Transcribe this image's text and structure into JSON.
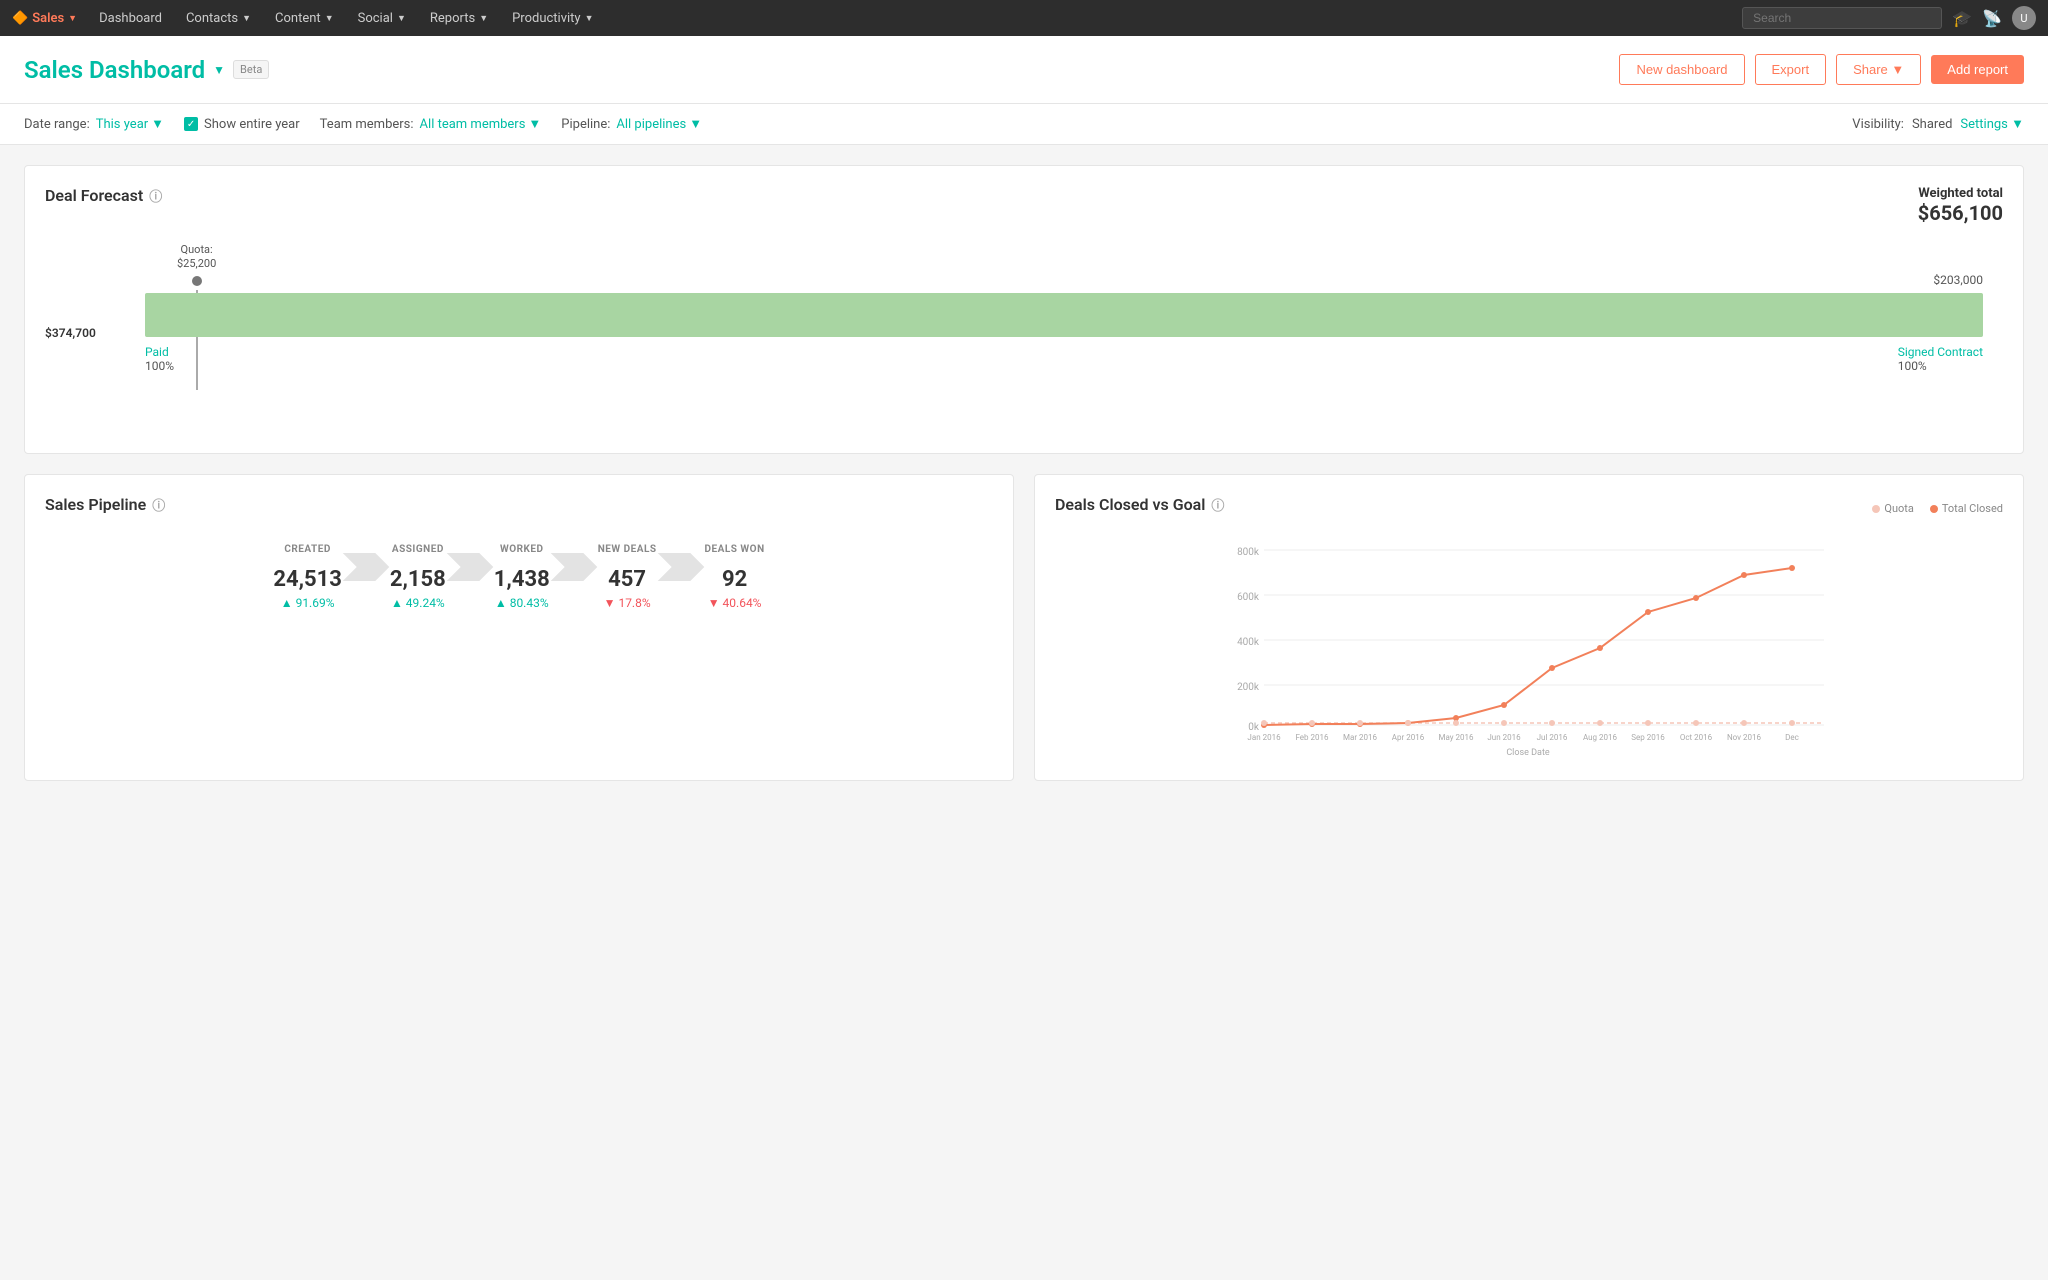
{
  "nav": {
    "brand": "Sales",
    "items": [
      "Dashboard",
      "Contacts",
      "Content",
      "Social",
      "Reports",
      "Productivity"
    ],
    "search_placeholder": "Search"
  },
  "header": {
    "title": "Sales Dashboard",
    "beta_label": "Beta",
    "actions": {
      "new_dashboard": "New dashboard",
      "export": "Export",
      "share": "Share",
      "add_report": "Add report"
    }
  },
  "filters": {
    "date_range_label": "Date range:",
    "date_range_value": "This year",
    "show_entire_year": "Show entire year",
    "team_members_label": "Team members:",
    "team_members_value": "All team members",
    "pipeline_label": "Pipeline:",
    "pipeline_value": "All pipelines",
    "visibility_label": "Visibility:",
    "visibility_value": "Shared",
    "settings": "Settings"
  },
  "deal_forecast": {
    "title": "Deal Forecast",
    "weighted_label": "Weighted total",
    "weighted_amount": "$656,100",
    "bar_left_value": "$374,700",
    "bar_right_value": "$203,000",
    "quota_label": "Quota:",
    "quota_amount": "$25,200",
    "stages": [
      {
        "name": "Paid",
        "pct": "100%"
      },
      {
        "name": "Signed Contract",
        "pct": "100%"
      }
    ]
  },
  "sales_pipeline": {
    "title": "Sales Pipeline",
    "stages": [
      {
        "label": "CREATED",
        "value": "24,513",
        "change": "▲ 91.69%",
        "up": true
      },
      {
        "label": "ASSIGNED",
        "value": "2,158",
        "change": "▲ 49.24%",
        "up": true
      },
      {
        "label": "WORKED",
        "value": "1,438",
        "change": "▲ 80.43%",
        "up": true
      },
      {
        "label": "NEW DEALS",
        "value": "457",
        "change": "▼ 17.8%",
        "up": false
      },
      {
        "label": "DEALS WON",
        "value": "92",
        "change": "▼ 40.64%",
        "up": false
      }
    ]
  },
  "deals_closed": {
    "title": "Deals Closed vs Goal",
    "legend": [
      {
        "label": "Quota",
        "color": "#f5c6b8"
      },
      {
        "label": "Total Closed",
        "color": "#f2805a"
      }
    ],
    "y_labels": [
      "800k",
      "600k",
      "400k",
      "200k",
      "0k"
    ],
    "x_labels": [
      "Jan 2016",
      "Feb 2016",
      "Mar 2016",
      "Apr 2016",
      "May 2016",
      "Jun 2016",
      "Jul 2016",
      "Aug 2016",
      "Sep 2016",
      "Oct 2016",
      "Nov 2016",
      "Dec"
    ],
    "x_axis_label": "Close Date"
  },
  "colors": {
    "teal": "#00bda5",
    "orange": "#ff7a59",
    "green_bar": "#a8d5a2",
    "up": "#00bda5",
    "down": "#f2545b"
  }
}
